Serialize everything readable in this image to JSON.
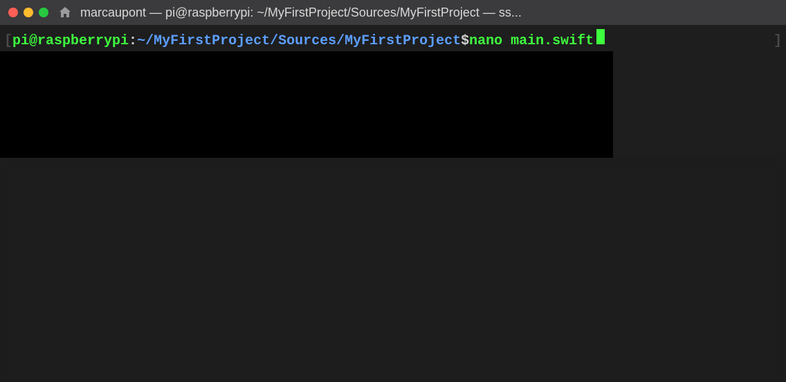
{
  "titlebar": {
    "title": "marcaupont — pi@raspberrypi: ~/MyFirstProject/Sources/MyFirstProject — ss..."
  },
  "prompt": {
    "left_bracket": "[",
    "user_host": "pi@raspberrypi",
    "colon": ":",
    "path": "~/MyFirstProject/Sources/MyFirstProject",
    "dollar": " $ ",
    "command": "nano main.swift ",
    "right_bracket": "]"
  }
}
